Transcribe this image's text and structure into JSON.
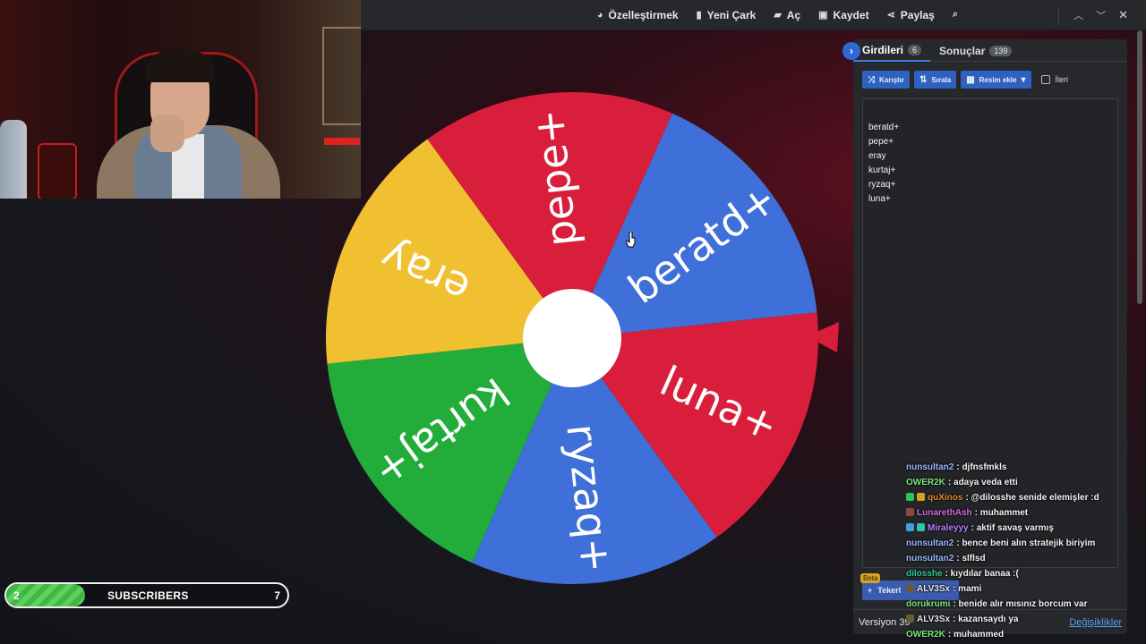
{
  "toolbar": {
    "items": [
      {
        "label": "Özelleştirmek",
        "icon": "palette-icon"
      },
      {
        "label": "Yeni Çark",
        "icon": "file-icon"
      },
      {
        "label": "Aç",
        "icon": "folder-open-icon"
      },
      {
        "label": "Kaydet",
        "icon": "save-icon"
      },
      {
        "label": "Paylaş",
        "icon": "share-icon"
      }
    ],
    "search_icon": "search-icon"
  },
  "wheel": {
    "segments": [
      {
        "label": "beratd+",
        "color": "#3f6fd8"
      },
      {
        "label": "luna+",
        "color": "#d81e3a"
      },
      {
        "label": "ryzaq+",
        "color": "#3f6fd8"
      },
      {
        "label": "kurtaj+",
        "color": "#22ac3a"
      },
      {
        "label": "eray",
        "color": "#f0c030"
      },
      {
        "label": "pepe+",
        "color": "#d81e3a"
      }
    ],
    "pointer_color": "#d81e3a"
  },
  "panel": {
    "tab_entries": {
      "label": "Girdileri",
      "count": "6"
    },
    "tab_results": {
      "label": "Sonuçlar",
      "count": "139"
    },
    "buttons": {
      "shuffle": "Karıştır",
      "sort": "Sırala",
      "image": "Resim ekle"
    },
    "advanced_label": "İleri",
    "entries": [
      "beratd+",
      "pepe+",
      "eray",
      "kurtaj+",
      "ryzaq+",
      "luna+"
    ],
    "beta": "Beta",
    "add_wheel": "Tekerl",
    "version": "Versiyon 39",
    "changes": "Değişiklikler"
  },
  "chat": [
    {
      "user": "nunsultan2",
      "color": "#9ab8ff",
      "text": ": djfnsfmkls",
      "icons": []
    },
    {
      "user": "OWER2K",
      "color": "#7de67d",
      "text": ": adaya veda etti",
      "icons": []
    },
    {
      "user": "quXinos",
      "color": "#e08a2c",
      "text": ": @dilosshe senide elemişler :d",
      "icons": [
        "#2ec25a",
        "#d4a020"
      ]
    },
    {
      "user": "LunarethAsh",
      "color": "#d86ae0",
      "text": ": muhammet",
      "icons": [
        "#8a4a3a"
      ]
    },
    {
      "user": "Miraleyyy",
      "color": "#b580ff",
      "text": ": aktif savaş varmış",
      "icons": [
        "#3aa0e0",
        "#2ec2b0"
      ]
    },
    {
      "user": "nunsultan2",
      "color": "#9ab8ff",
      "text": ": bence beni alın stratejik biriyim",
      "icons": []
    },
    {
      "user": "nunsultan2",
      "color": "#9ab8ff",
      "text": ": slflsd",
      "icons": []
    },
    {
      "user": "dilosshe",
      "color": "#34c6a0",
      "text": ": kıydılar banaa :(",
      "icons": []
    },
    {
      "user": "ALV3Sx",
      "color": "#e6e6e6",
      "text": ": mami",
      "icons": [
        "#6a5a3a"
      ]
    },
    {
      "user": "dorukrumi",
      "color": "#7de67d",
      "text": ": benide alır mısınız borcum var",
      "icons": []
    },
    {
      "user": "ALV3Sx",
      "color": "#e6e6e6",
      "text": ": kazansaydı ya",
      "icons": [
        "#6a5a3a"
      ]
    },
    {
      "user": "OWER2K",
      "color": "#7de67d",
      "text": ": muhammed",
      "icons": []
    }
  ],
  "subscribers": {
    "current": "2",
    "label": "SUBSCRIBERS",
    "goal": "7",
    "progress": 0.28
  }
}
